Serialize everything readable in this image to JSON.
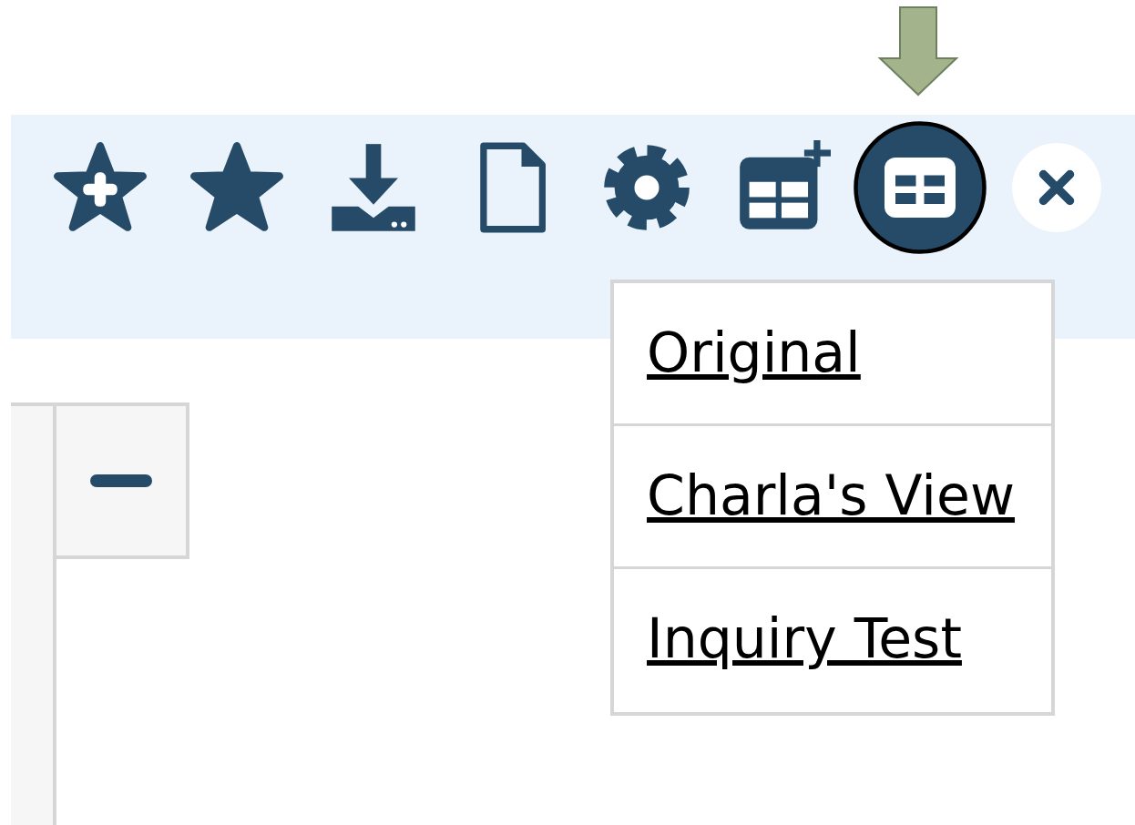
{
  "toolbar": {
    "buttons": [
      {
        "kind": "favorite-add",
        "selected": false
      },
      {
        "kind": "favorite",
        "selected": false
      },
      {
        "kind": "download",
        "selected": false
      },
      {
        "kind": "document",
        "selected": false
      },
      {
        "kind": "settings",
        "selected": false
      },
      {
        "kind": "view-add",
        "selected": false
      },
      {
        "kind": "view",
        "selected": true
      },
      {
        "kind": "close",
        "selected": false
      }
    ]
  },
  "view_menu": {
    "items": [
      {
        "label": "Original"
      },
      {
        "label": "Charla's View"
      },
      {
        "label": "Inquiry Test"
      }
    ]
  }
}
